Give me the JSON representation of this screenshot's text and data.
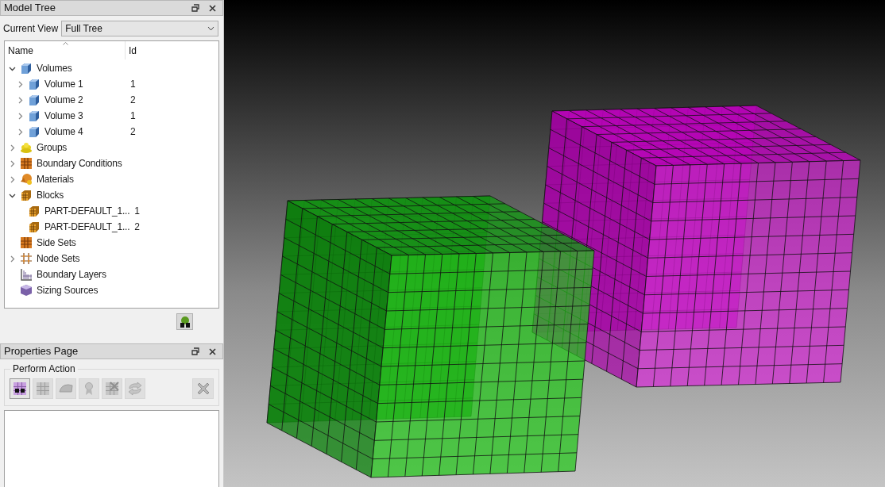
{
  "model_tree": {
    "title": "Model Tree",
    "current_view_label": "Current View",
    "current_view": "Full Tree",
    "columns": [
      "Name",
      "Id"
    ],
    "items": [
      {
        "kind": "volume",
        "name": "Volumes",
        "expanded": true,
        "children": [
          {
            "kind": "volume",
            "name": "Volume 1",
            "id": "1",
            "expanded": false
          },
          {
            "kind": "volume",
            "name": "Volume 2",
            "id": "2",
            "expanded": false
          },
          {
            "kind": "volume",
            "name": "Volume 3",
            "id": "1",
            "expanded": false
          },
          {
            "kind": "volume",
            "name": "Volume 4",
            "id": "2",
            "expanded": false
          }
        ]
      },
      {
        "kind": "group",
        "name": "Groups",
        "expanded": false
      },
      {
        "kind": "bc",
        "name": "Boundary Conditions",
        "expanded": false
      },
      {
        "kind": "material",
        "name": "Materials",
        "expanded": false
      },
      {
        "kind": "block",
        "name": "Blocks",
        "expanded": true,
        "children": [
          {
            "kind": "block",
            "name": "PART-DEFAULT_1...",
            "id": "1"
          },
          {
            "kind": "block",
            "name": "PART-DEFAULT_1...",
            "id": "2"
          }
        ]
      },
      {
        "kind": "bc",
        "name": "Side Sets"
      },
      {
        "kind": "nodeset",
        "name": "Node Sets",
        "expanded": false
      },
      {
        "kind": "layer",
        "name": "Boundary Layers"
      },
      {
        "kind": "sizing",
        "name": "Sizing Sources"
      }
    ]
  },
  "properties_page": {
    "title": "Properties Page",
    "group_label": "Perform Action",
    "actions": [
      {
        "kind": "find",
        "disabled": false
      },
      {
        "kind": "grid",
        "disabled": true
      },
      {
        "kind": "iron",
        "disabled": true
      },
      {
        "kind": "award",
        "disabled": true
      },
      {
        "kind": "gridx",
        "disabled": true
      },
      {
        "kind": "swap",
        "disabled": true
      },
      {
        "kind": "delete",
        "disabled": true
      }
    ]
  }
}
